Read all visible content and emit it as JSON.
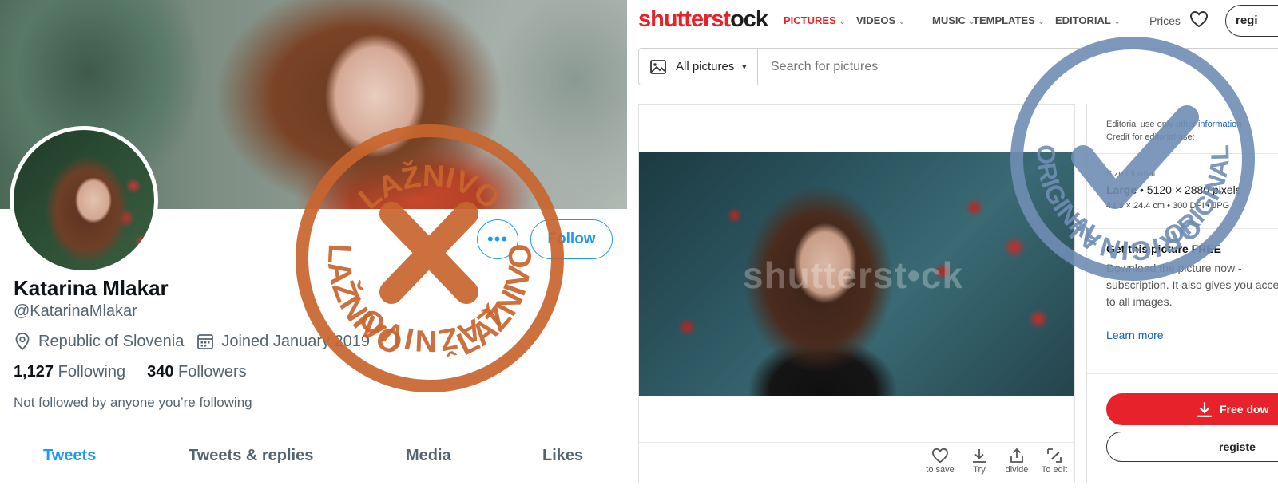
{
  "twitter": {
    "name": "Katarina Mlakar",
    "handle": "@KatarinaMlakar",
    "location": "Republic of Slovenia",
    "joined": "Joined January 2019",
    "following_count": "1,127",
    "following_label": "Following",
    "followers_count": "340",
    "followers_label": "Followers",
    "not_followed": "Not followed by anyone you’re following",
    "more_label": "•••",
    "follow_label": "Follow",
    "tabs": [
      "Tweets",
      "Tweets & replies",
      "Media",
      "Likes"
    ],
    "accent": "#1d9bf0"
  },
  "stamp_fake": {
    "word_top": "LAŽNIVO",
    "word_left": "LAŽNIVO",
    "word_right": "LAŽNIVO",
    "mark": "X",
    "color": "#c8652e"
  },
  "stamp_original": {
    "word_top": "ORIGINAL",
    "word_left": "ORIGINAL",
    "word_right": "ORIGINAL",
    "mark": "check",
    "color": "#6f8db4"
  },
  "shutterstock": {
    "logo_red": "shutterst",
    "logo_mark": "o",
    "logo_dark": "ck",
    "nav": [
      "PICTURES",
      "VIDEOS",
      "MUSIC",
      "TEMPLATES",
      "EDITORIAL"
    ],
    "prices": "Prices",
    "register_top": "regi",
    "search_type": "All pictures",
    "search_placeholder": "Search for pictures",
    "watermark": "shutterst•ck",
    "actions": [
      "to save",
      "Try",
      "divide",
      "To edit"
    ],
    "editorial_line1": "Editorial use only",
    "editorial_link": "other information",
    "editorial_line2": "Credit for editorial use:",
    "size_label": "Size / format",
    "size_name": "Large",
    "size_value": "• 5120 × 2880 pixels",
    "dims": "43.3 × 24.4 cm • 300 DPI • JPG",
    "get_title": "Get this picture FREE",
    "get_desc": "Download the picture now - subscription. It also gives you access to all images.",
    "learn_more": "Learn more",
    "free_btn": "Free dow",
    "register_btn": "registe",
    "brand_color": "#e8222a"
  }
}
